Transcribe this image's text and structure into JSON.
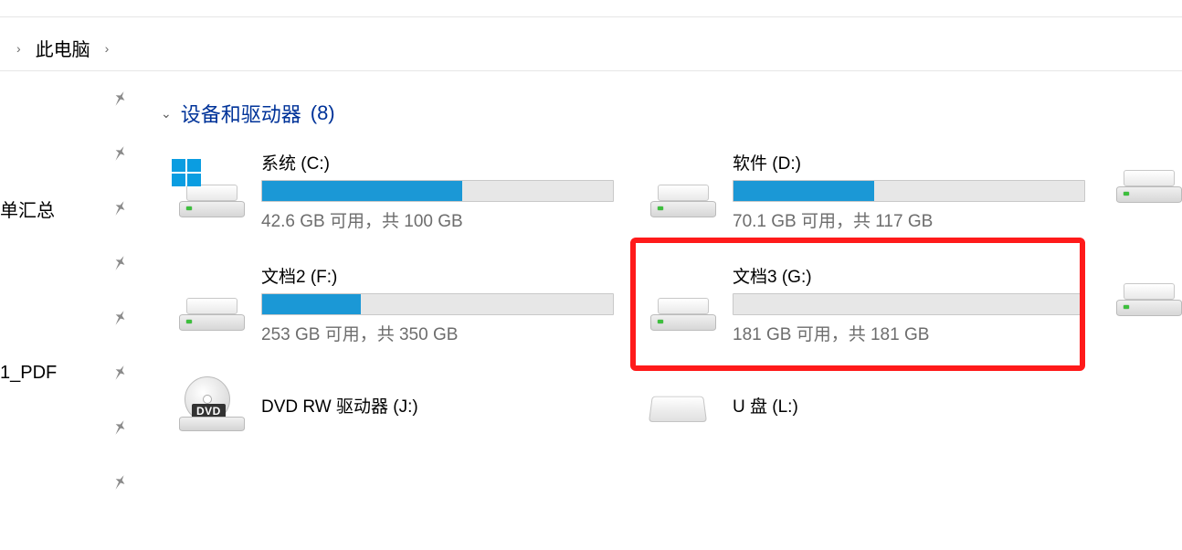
{
  "breadcrumb": {
    "location": "此电脑"
  },
  "sidebar": {
    "items": [
      {
        "label": ""
      },
      {
        "label": ""
      },
      {
        "label": "单汇总"
      },
      {
        "label": ""
      },
      {
        "label": ""
      },
      {
        "label": "1_PDF"
      },
      {
        "label": ""
      },
      {
        "label": ""
      }
    ]
  },
  "section": {
    "title": "设备和驱动器",
    "count_suffix": "(8)"
  },
  "drives": [
    {
      "name": "系统 (C:)",
      "free": "42.6 GB",
      "total": "100 GB",
      "pct_used": 57,
      "icon": "hdd-win",
      "has_bar": true
    },
    {
      "name": "软件 (D:)",
      "free": "70.1 GB",
      "total": "117 GB",
      "pct_used": 40,
      "icon": "hdd",
      "has_bar": true
    },
    {
      "name": "",
      "free": "",
      "total": "",
      "pct_used": 0,
      "icon": "hdd",
      "has_bar": false
    },
    {
      "name": "文档2 (F:)",
      "free": "253 GB",
      "total": "350 GB",
      "pct_used": 28,
      "icon": "hdd",
      "has_bar": true
    },
    {
      "name": "文档3 (G:)",
      "free": "181 GB",
      "total": "181 GB",
      "pct_used": 0,
      "icon": "hdd",
      "has_bar": true
    },
    {
      "name": "",
      "free": "",
      "total": "",
      "pct_used": 0,
      "icon": "hdd",
      "has_bar": false
    },
    {
      "name": "DVD RW 驱动器 (J:)",
      "free": "",
      "total": "",
      "pct_used": 0,
      "icon": "dvd",
      "has_bar": false
    },
    {
      "name": "U 盘 (L:)",
      "free": "",
      "total": "",
      "pct_used": 0,
      "icon": "flat",
      "has_bar": false
    }
  ],
  "status_template": {
    "sep": " 可用，共 "
  },
  "dvd_badge": "DVD"
}
